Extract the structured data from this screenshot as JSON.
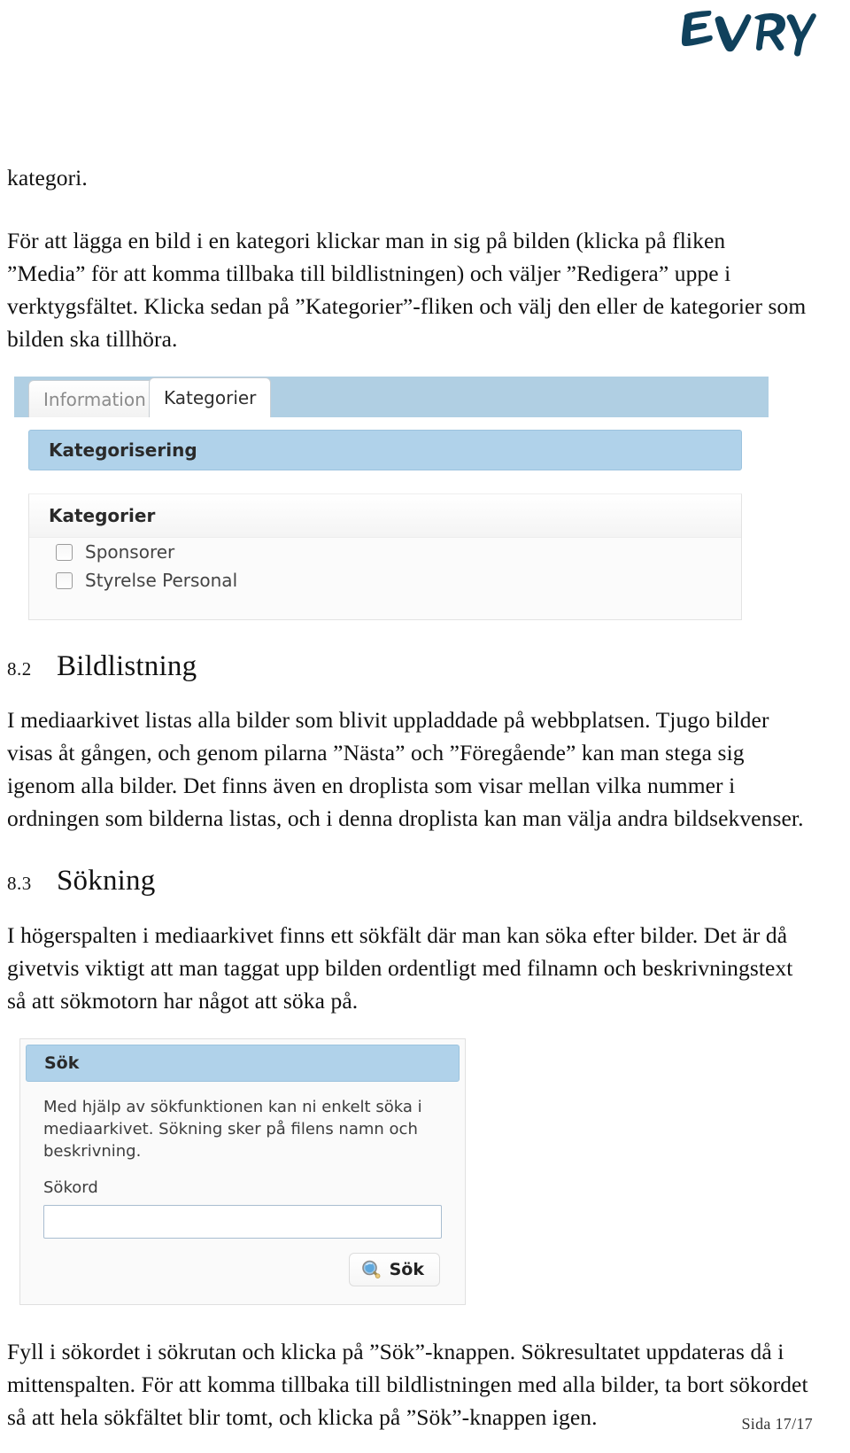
{
  "header": {
    "logo_text": "EVRY",
    "logo_color": "#10415c"
  },
  "document": {
    "continued_word": "kategori.",
    "intro_paragraph": "För att lägga en bild i en kategori klickar man in sig på bilden (klicka på fliken ”Media” för att komma tillbaka till bildlistningen) och väljer ”Redigera” uppe i verktygsfältet. Klicka sedan på ”Kategorier”-fliken och välj den eller de kategorier som bilden ska tillhöra."
  },
  "categories_screenshot": {
    "tabs": [
      {
        "label": "Information",
        "active": false
      },
      {
        "label": "Kategorier",
        "active": true
      }
    ],
    "section_header": "Kategorisering",
    "panel_title": "Kategorier",
    "checkboxes": [
      {
        "label": "Sponsorer",
        "checked": false
      },
      {
        "label": "Styrelse Personal",
        "checked": false
      }
    ],
    "colors": {
      "tabstrip_blue": "#b0cfe3",
      "header_blue": "#b0d2ea",
      "panel_bg": "#fbfbfb"
    }
  },
  "section_82": {
    "number": "8.2",
    "title": "Bildlistning",
    "paragraph": "I mediaarkivet listas alla bilder som blivit uppladdade på webbplatsen. Tjugo bilder visas åt gången, och genom pilarna ”Nästa” och ”Föregående” kan man stega sig igenom alla bilder. Det finns även en droplista som visar mellan vilka nummer i ordningen som bilderna listas, och i denna droplista kan man välja andra bildsekvenser."
  },
  "section_83": {
    "number": "8.3",
    "title": "Sökning",
    "paragraph": "I högerspalten i mediaarkivet finns ett sökfält där man kan söka efter bilder. Det är då givetvis viktigt att man taggat upp bilden ordentligt med filnamn och beskrivningstext så att sökmotorn har något att söka på."
  },
  "search_screenshot": {
    "header_title": "Sök",
    "description": "Med hjälp av sökfunktionen kan ni enkelt söka i mediaarkivet. Sökning sker på filens namn och beskrivning.",
    "field_label": "Sökord",
    "field_value": "",
    "field_placeholder": "",
    "button_label": "Sök",
    "button_icon": "magnifier-icon"
  },
  "closing": {
    "paragraph": "Fyll i sökordet i sökrutan och klicka på ”Sök”-knappen. Sökresultatet uppdateras då i mittenspalten. För att komma tillbaka till bildlistningen med alla bilder, ta bort sökordet så att hela sökfältet blir tomt, och klicka på ”Sök”-knappen igen."
  },
  "footer": {
    "page_label": "Sida 17/17"
  }
}
